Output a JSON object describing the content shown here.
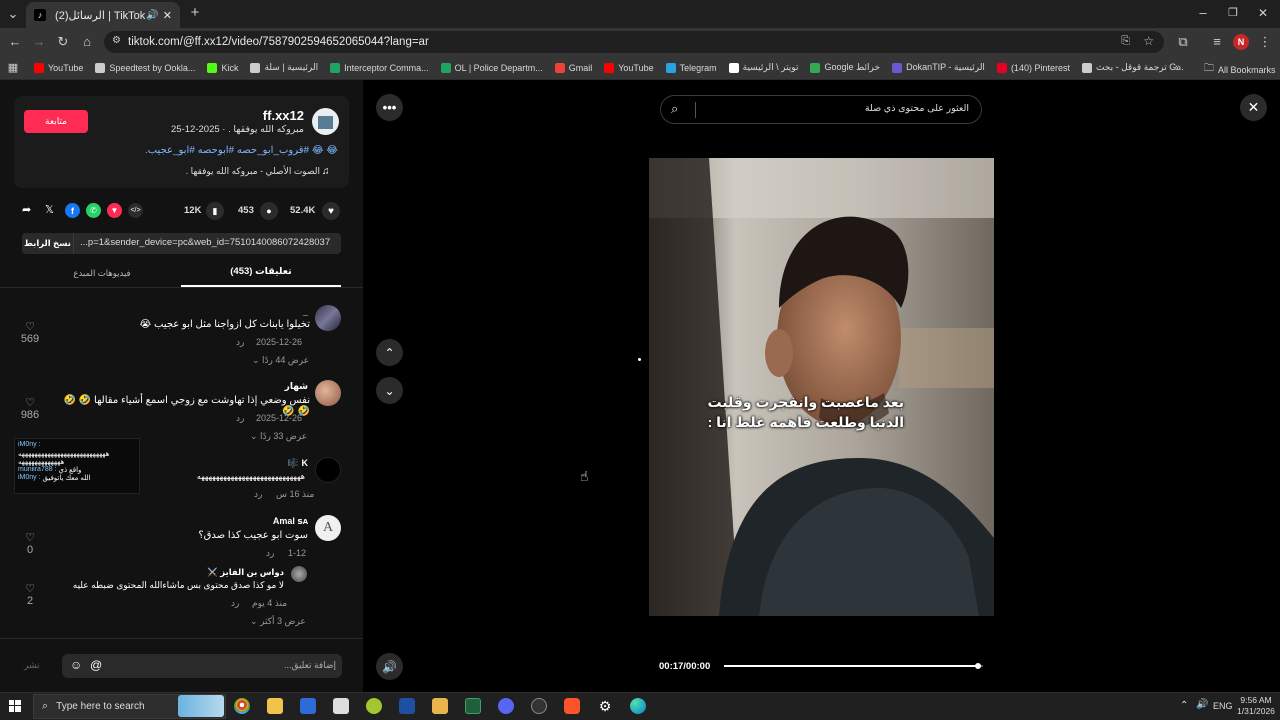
{
  "browser": {
    "tab_title": "(2)الرسائل | TikTok",
    "url": "tiktok.com/@ff.xx12/video/7587902594652065044?lang=ar",
    "bookmarks": [
      {
        "label": "YouTube",
        "color": "#ff0000"
      },
      {
        "label": "Speedtest by Ookla...",
        "color": "#cccccc"
      },
      {
        "label": "Kick",
        "color": "#53fc18"
      },
      {
        "label": "الرئيسية | سلة",
        "color": "#cccccc"
      },
      {
        "label": "Interceptor Comma...",
        "color": "#1fa463"
      },
      {
        "label": "OL | Police Departm...",
        "color": "#1fa463"
      },
      {
        "label": "Gmail",
        "color": "#ea4335"
      },
      {
        "label": "YouTube",
        "color": "#ff0000"
      },
      {
        "label": "Telegram",
        "color": "#2aa3e0"
      },
      {
        "label": "تويتر \\ الرئيسية",
        "color": "#ffffff"
      },
      {
        "label": "Google خرائط",
        "color": "#34a853"
      },
      {
        "label": "DokanTIP - الرئيسية",
        "color": "#6a5acd"
      },
      {
        "label": "(140) Pinterest",
        "color": "#e60023"
      },
      {
        "label": "ترجمة قوقل - بحث G...",
        "color": "#cccccc"
      }
    ],
    "all_bookmarks": "All Bookmarks",
    "profile_initial": "N"
  },
  "post": {
    "username": "ff.xx12",
    "subtitle": "مبروكه الله يوفقها . · 2025-12-25",
    "follow_label": "متابعة",
    "hashtags": "😂 😂 #قروب_ابو_حصه #ابوحصه #ابو_عجيب.",
    "sound": "الصوت الأصلي - مبروكه الله يوفقها .",
    "likes": "52.4K",
    "comments": "453",
    "saves": "12K",
    "link": "...p=1&sender_device=pc&web_id=7510140086072428037",
    "copy_link_label": "نسخ الرابط"
  },
  "tabs": {
    "comments": "تعليقات (453)",
    "creator_videos": "فيديوهات المبدع"
  },
  "comments": [
    {
      "name": "_",
      "text": "تخيلوا يابنات كل ازواجنا مثل ابو عجيب 😭",
      "date": "2025-12-26",
      "reply": "رد",
      "view_more": "عرض 44 ردًا",
      "likes": "569"
    },
    {
      "name": "شهار",
      "text": "نفس وضعي إذا تهاوشت مع زوجي اسمع أشياء مقالها 🤣 🤣 🤣 🤣",
      "date": "2025-12-26",
      "reply": "رد",
      "view_more": "عرض 33 ردًا",
      "likes": "986"
    },
    {
      "name": "K 🎼",
      "text": "ههههههههههههههههههههههههههههه",
      "date": "منذ 16 س",
      "reply": "رد",
      "likes": ""
    },
    {
      "name": "Amal ꜱᴀ",
      "text": "سوت ابو عجيب كذا صدق؟",
      "date": "1-12",
      "reply": "رد",
      "likes": "0"
    },
    {
      "name": "دواس بن الفايز ⚔️",
      "text": "لا مو كذا صدق محتوى بس ماشاءالله المحتوى ضبطه عليه",
      "date": "منذ 4 يوم",
      "reply": "رد",
      "view_more": "عرض 3 أكثر",
      "likes": "2"
    }
  ],
  "live_chat": {
    "lines": [
      {
        "user": "iM0ny :",
        "text": ""
      },
      {
        "user": "",
        "text": "هههههههههههههههههههههههههههه"
      },
      {
        "user": "",
        "text": "هههههههههههههه"
      },
      {
        "user": "muniira788 :",
        "text": "واقع ذي"
      },
      {
        "user": "iM0ny :",
        "text": "الله معك ياتوفيق"
      }
    ]
  },
  "comment_input": {
    "placeholder": "إضافة تعليق...",
    "post_label": "نشر"
  },
  "search": {
    "placeholder": "العثور على محتوى ذي صلة"
  },
  "video": {
    "caption_line1": "بعد ماعصبت وانفجرت وقلبت",
    "caption_line2": "الدنيا وطلعت فاهمه غلط انا :",
    "time": "00:17/00:00",
    "progress": 0.98
  },
  "taskbar": {
    "search_placeholder": "Type here to search",
    "lang": "ENG",
    "time": "9:56 AM",
    "date": "1/31/2026"
  }
}
